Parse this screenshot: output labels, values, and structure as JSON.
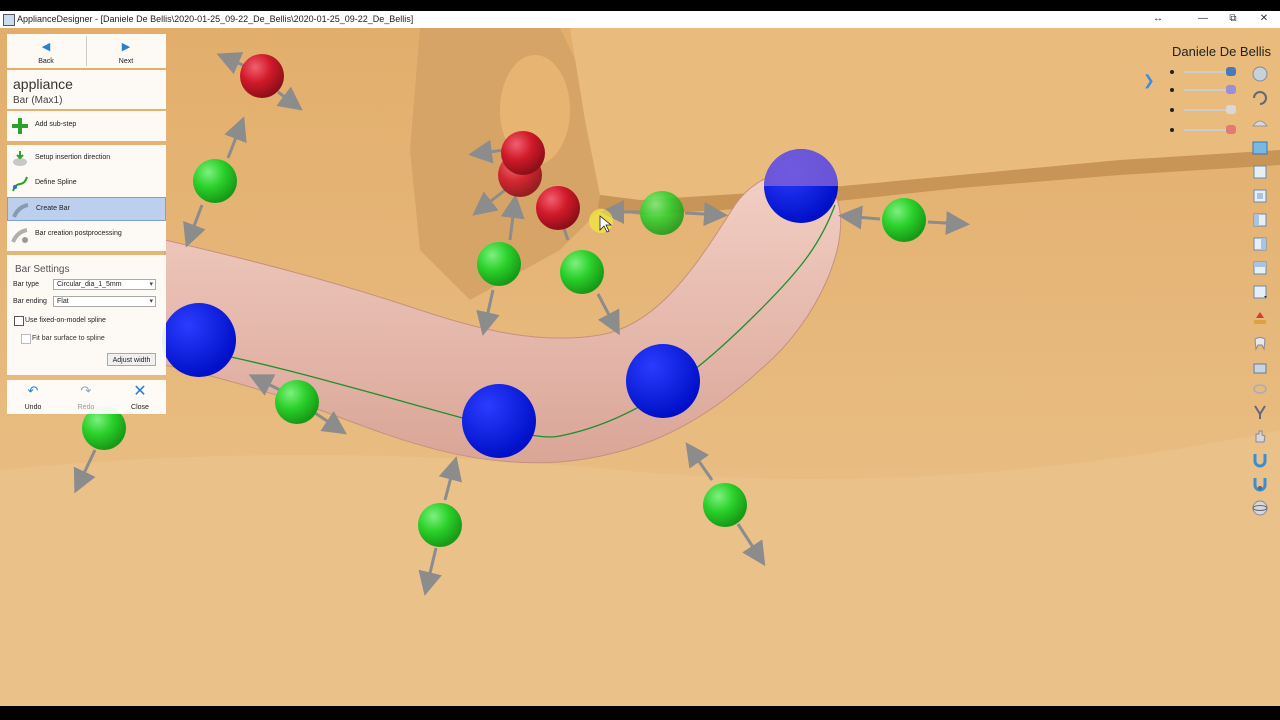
{
  "window": {
    "title": "ApplianceDesigner - [Daniele De Bellis\\2020-01-25_09-22_De_Bellis\\2020-01-25_09-22_De_Bellis]",
    "minimize": "—",
    "maximize": "⧉",
    "close": "✕",
    "resize_indicator": "↔"
  },
  "nav": {
    "back_label": "Back",
    "next_label": "Next"
  },
  "step": {
    "title": "appliance",
    "subtitle": "Bar (Max1)"
  },
  "add_substep_label": "Add sub-step",
  "steps": [
    {
      "label": "Setup insertion direction",
      "icon": "insertion-direction-icon",
      "selected": false
    },
    {
      "label": "Define Spline",
      "icon": "spline-icon",
      "selected": false
    },
    {
      "label": "Create Bar",
      "icon": "bar-icon",
      "selected": true
    },
    {
      "label": "Bar creation postprocessing",
      "icon": "postprocessing-icon",
      "selected": false
    }
  ],
  "bar_settings": {
    "title": "Bar Settings",
    "bar_type_label": "Bar type",
    "bar_type_value": "Circular_dia_1_5mm",
    "bar_ending_label": "Bar ending",
    "bar_ending_value": "Flat",
    "fixed_spline_label": "Use fixed-on-model spline",
    "fit_surface_label": "Fit bar surface to spline",
    "adjust_width_label": "Adjust width"
  },
  "actions": {
    "undo_label": "Undo",
    "redo_label": "Redo",
    "close_label": "Close"
  },
  "user_name": "Daniele De Bellis",
  "colors": {
    "model": "#e6b677",
    "bar": "#e7b8ab",
    "spline": "#1f8f2e",
    "control_point_blue": "#0a1ee0",
    "control_point_green": "#2bd12b",
    "control_point_red": "#d11a2a",
    "accent": "#2a7fd0",
    "selection": "#bcd0ee"
  },
  "opacity_sliders": [
    {
      "name": "slider-1",
      "knob_color": "#4a78b8"
    },
    {
      "name": "slider-2",
      "knob_color": "#9b8fd8"
    },
    {
      "name": "slider-3",
      "knob_color": "#d8d8d8"
    },
    {
      "name": "slider-4",
      "knob_color": "#e07a72"
    }
  ],
  "tools": [
    "view-cube-icon",
    "rotate-icon",
    "scan-icon",
    "panel-icon",
    "cube-front-icon",
    "cube-back-icon",
    "cube-left-icon",
    "cube-right-icon",
    "cube-top-icon",
    "cube-bottom-icon",
    "paint-icon",
    "tooth-icon",
    "box-icon",
    "lasso-icon",
    "measure-icon",
    "hand-icon",
    "magnet-icon",
    "magnet-alt-icon",
    "sphere-icon"
  ]
}
